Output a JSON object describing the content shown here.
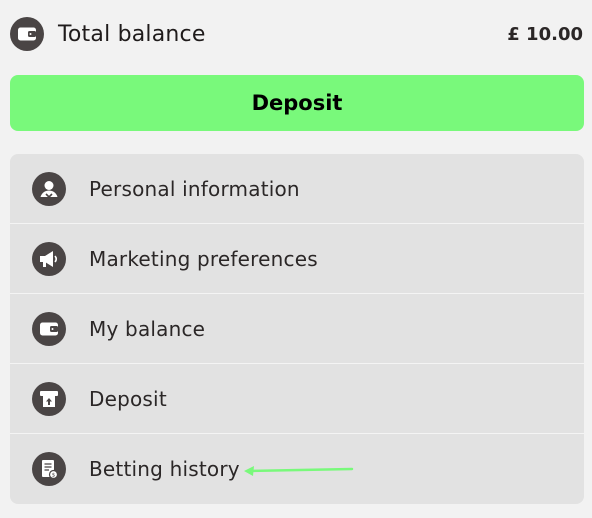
{
  "balance": {
    "label": "Total balance",
    "amount": "£ 10.00",
    "icon": "wallet-icon"
  },
  "deposit_button": {
    "label": "Deposit",
    "color": "#79f97b"
  },
  "menu": {
    "items": [
      {
        "label": "Personal information",
        "icon": "user-icon"
      },
      {
        "label": "Marketing preferences",
        "icon": "megaphone-icon"
      },
      {
        "label": "My balance",
        "icon": "wallet-icon"
      },
      {
        "label": "Deposit",
        "icon": "atm-deposit-icon"
      },
      {
        "label": "Betting history",
        "icon": "receipt-icon"
      }
    ]
  },
  "annotation": {
    "arrow_color": "#79f97b",
    "points_to": "Betting history"
  },
  "colors": {
    "icon_bg": "#4a4545",
    "menu_bg": "#e2e2e2",
    "page_bg": "#f2f2f2"
  }
}
